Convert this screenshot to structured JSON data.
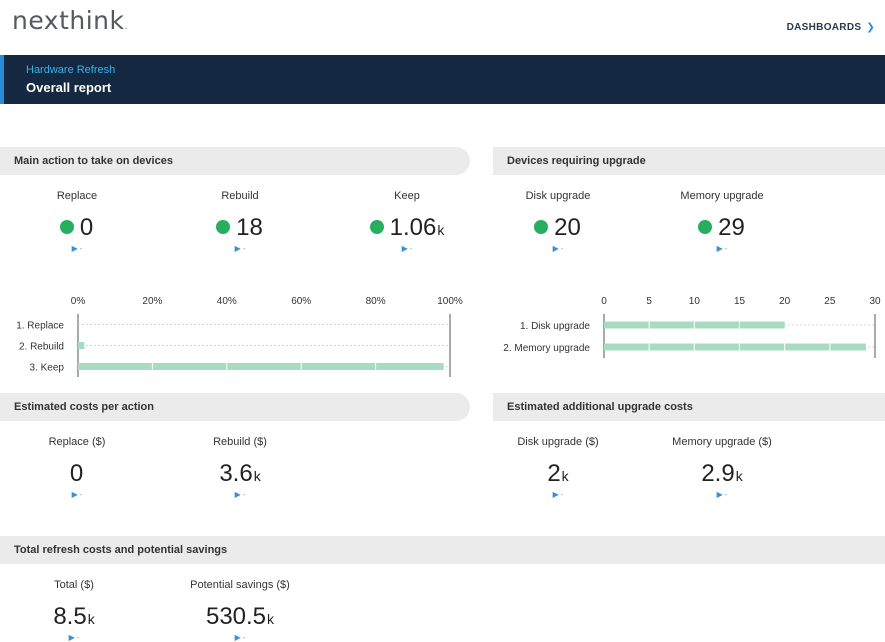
{
  "header": {
    "logo": "nexthink",
    "logo_suffix": ".",
    "dashboards_label": "DASHBOARDS"
  },
  "banner": {
    "breadcrumb": "Hardware Refresh",
    "title": "Overall report"
  },
  "sections": {
    "main_action": "Main action to take on devices",
    "devices_upgrade": "Devices requiring upgrade",
    "est_costs": "Estimated costs per action",
    "est_upgrade_costs": "Estimated additional upgrade costs",
    "total_refresh": "Total refresh costs and potential savings"
  },
  "kpis": {
    "replace": {
      "label": "Replace",
      "value": "0",
      "unit": "",
      "status_color": "#27ae60"
    },
    "rebuild": {
      "label": "Rebuild",
      "value": "18",
      "unit": "",
      "status_color": "#27ae60"
    },
    "keep": {
      "label": "Keep",
      "value": "1.06",
      "unit": "k",
      "status_color": "#27ae60"
    },
    "disk_upgrade": {
      "label": "Disk upgrade",
      "value": "20",
      "unit": "",
      "status_color": "#27ae60"
    },
    "memory_upgrade": {
      "label": "Memory upgrade",
      "value": "29",
      "unit": "",
      "status_color": "#27ae60"
    },
    "replace_cost": {
      "label": "Replace ($)",
      "value": "0",
      "unit": ""
    },
    "rebuild_cost": {
      "label": "Rebuild ($)",
      "value": "3.6",
      "unit": "k"
    },
    "disk_cost": {
      "label": "Disk upgrade ($)",
      "value": "2",
      "unit": "k"
    },
    "memory_cost": {
      "label": "Memory upgrade ($)",
      "value": "2.9",
      "unit": "k"
    },
    "total_cost": {
      "label": "Total ($)",
      "value": "8.5",
      "unit": "k"
    },
    "savings": {
      "label": "Potential savings ($)",
      "value": "530.5",
      "unit": "k"
    }
  },
  "trend": {
    "arrow": "▶",
    "text": "-"
  },
  "chart_data": [
    {
      "type": "bar",
      "orientation": "horizontal",
      "categories": [
        "1. Replace",
        "2. Rebuild",
        "3. Keep"
      ],
      "values": [
        0,
        1.7,
        98.3
      ],
      "xlim": [
        0,
        100
      ],
      "ticks": [
        "0%",
        "20%",
        "40%",
        "60%",
        "80%",
        "100%"
      ],
      "color": "#a8dcc0"
    },
    {
      "type": "bar",
      "orientation": "horizontal",
      "categories": [
        "1. Disk upgrade",
        "2. Memory upgrade"
      ],
      "values": [
        20,
        29
      ],
      "xlim": [
        0,
        30
      ],
      "ticks": [
        "0",
        "5",
        "10",
        "15",
        "20",
        "25",
        "30"
      ],
      "color": "#a8dcc0"
    }
  ]
}
